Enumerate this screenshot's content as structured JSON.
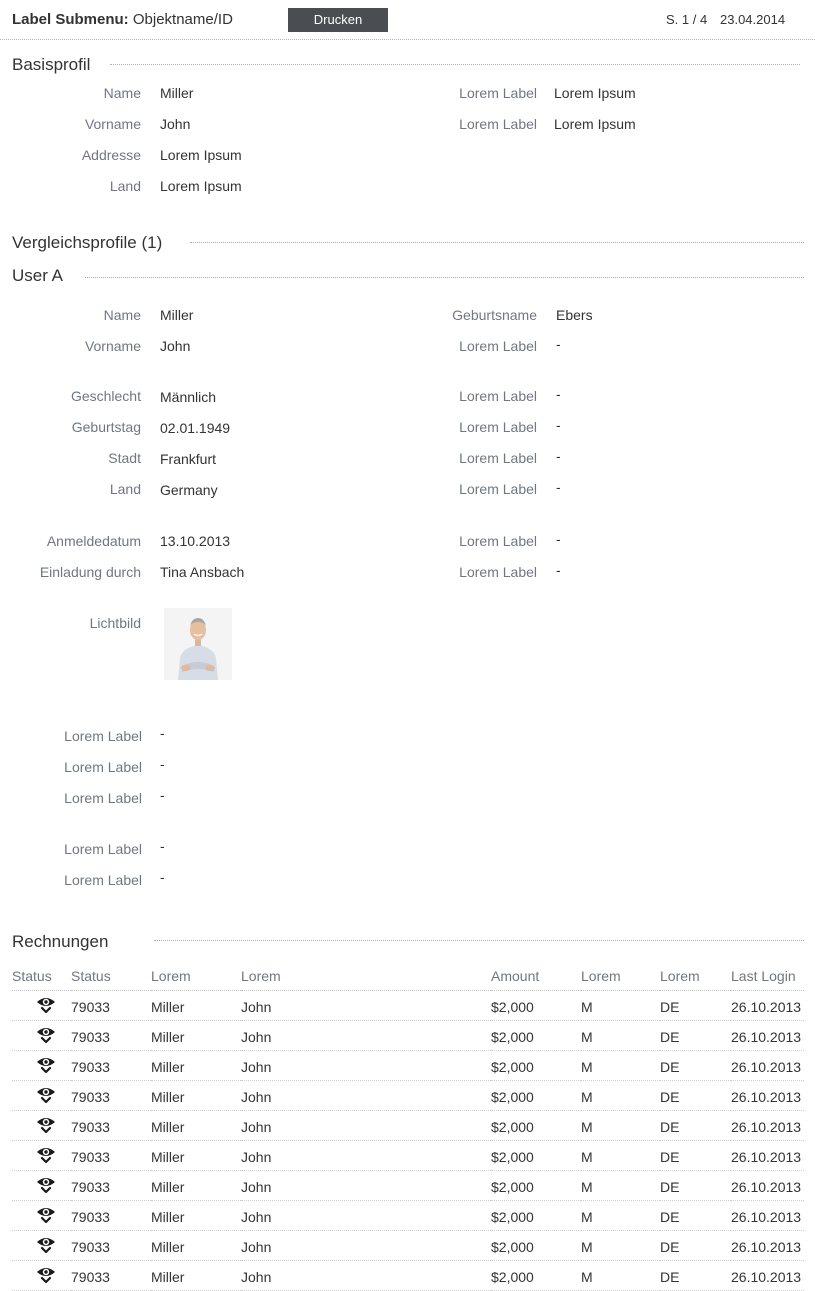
{
  "header": {
    "crumb_label": "Label Submenu:",
    "crumb_value": "Objektname/ID",
    "print_button": "Drucken",
    "page_info": "S. 1 / 4",
    "date": "23.04.2014"
  },
  "basisprofil": {
    "title": "Basisprofil",
    "left": [
      {
        "label": "Name",
        "value": "Miller"
      },
      {
        "label": "Vorname",
        "value": "John"
      },
      {
        "label": "Addresse",
        "value": "Lorem Ipsum"
      },
      {
        "label": "Land",
        "value": "Lorem Ipsum"
      }
    ],
    "right": [
      {
        "label": "Lorem Label",
        "value": "Lorem Ipsum"
      },
      {
        "label": "Lorem Label",
        "value": "Lorem Ipsum"
      }
    ]
  },
  "vergleichsprofile": {
    "title": "Vergleichsprofile (1)",
    "user_title": "User A",
    "left": [
      {
        "label": "Name",
        "value": "Miller"
      },
      {
        "label": "Vorname",
        "value": "John"
      },
      {
        "label": "Geschlecht",
        "value": "Männlich"
      },
      {
        "label": "Geburtstag",
        "value": "02.01.1949"
      },
      {
        "label": "Stadt",
        "value": "Frankfurt"
      },
      {
        "label": "Land",
        "value": "Germany"
      },
      {
        "label": "Anmeldedatum",
        "value": "13.10.2013"
      },
      {
        "label": "Einladung durch",
        "value": "Tina Ansbach"
      }
    ],
    "right": [
      {
        "label": "Geburtsname",
        "value": "Ebers"
      },
      {
        "label": "Lorem Label",
        "value": "-"
      },
      {
        "label": "Lorem Label",
        "value": "-"
      },
      {
        "label": "Lorem Label",
        "value": "-"
      },
      {
        "label": "Lorem Label",
        "value": "-"
      },
      {
        "label": "Lorem Label",
        "value": "-"
      },
      {
        "label": "Lorem Label",
        "value": "-"
      },
      {
        "label": "Lorem Label",
        "value": "-"
      }
    ],
    "photo_label": "Lichtbild",
    "extra": [
      {
        "label": "Lorem Label",
        "value": "-"
      },
      {
        "label": "Lorem Label",
        "value": "-"
      },
      {
        "label": "Lorem Label",
        "value": "-"
      },
      {
        "label": "Lorem Label",
        "value": "-"
      },
      {
        "label": "Lorem Label",
        "value": "-"
      }
    ]
  },
  "rechnungen": {
    "title": "Rechnungen",
    "columns": [
      "Status",
      "Status",
      "Lorem",
      "Lorem",
      "Amount",
      "Lorem",
      "Lorem",
      "Last Login"
    ],
    "status_icon": "eye-icon",
    "rows": [
      [
        "79033",
        "Miller",
        "John",
        "$2,000",
        "M",
        "DE",
        "26.10.2013"
      ],
      [
        "79033",
        "Miller",
        "John",
        "$2,000",
        "M",
        "DE",
        "26.10.2013"
      ],
      [
        "79033",
        "Miller",
        "John",
        "$2,000",
        "M",
        "DE",
        "26.10.2013"
      ],
      [
        "79033",
        "Miller",
        "John",
        "$2,000",
        "M",
        "DE",
        "26.10.2013"
      ],
      [
        "79033",
        "Miller",
        "John",
        "$2,000",
        "M",
        "DE",
        "26.10.2013"
      ],
      [
        "79033",
        "Miller",
        "John",
        "$2,000",
        "M",
        "DE",
        "26.10.2013"
      ],
      [
        "79033",
        "Miller",
        "John",
        "$2,000",
        "M",
        "DE",
        "26.10.2013"
      ],
      [
        "79033",
        "Miller",
        "John",
        "$2,000",
        "M",
        "DE",
        "26.10.2013"
      ],
      [
        "79033",
        "Miller",
        "John",
        "$2,000",
        "M",
        "DE",
        "26.10.2013"
      ],
      [
        "79033",
        "Miller",
        "John",
        "$2,000",
        "M",
        "DE",
        "26.10.2013"
      ]
    ]
  }
}
